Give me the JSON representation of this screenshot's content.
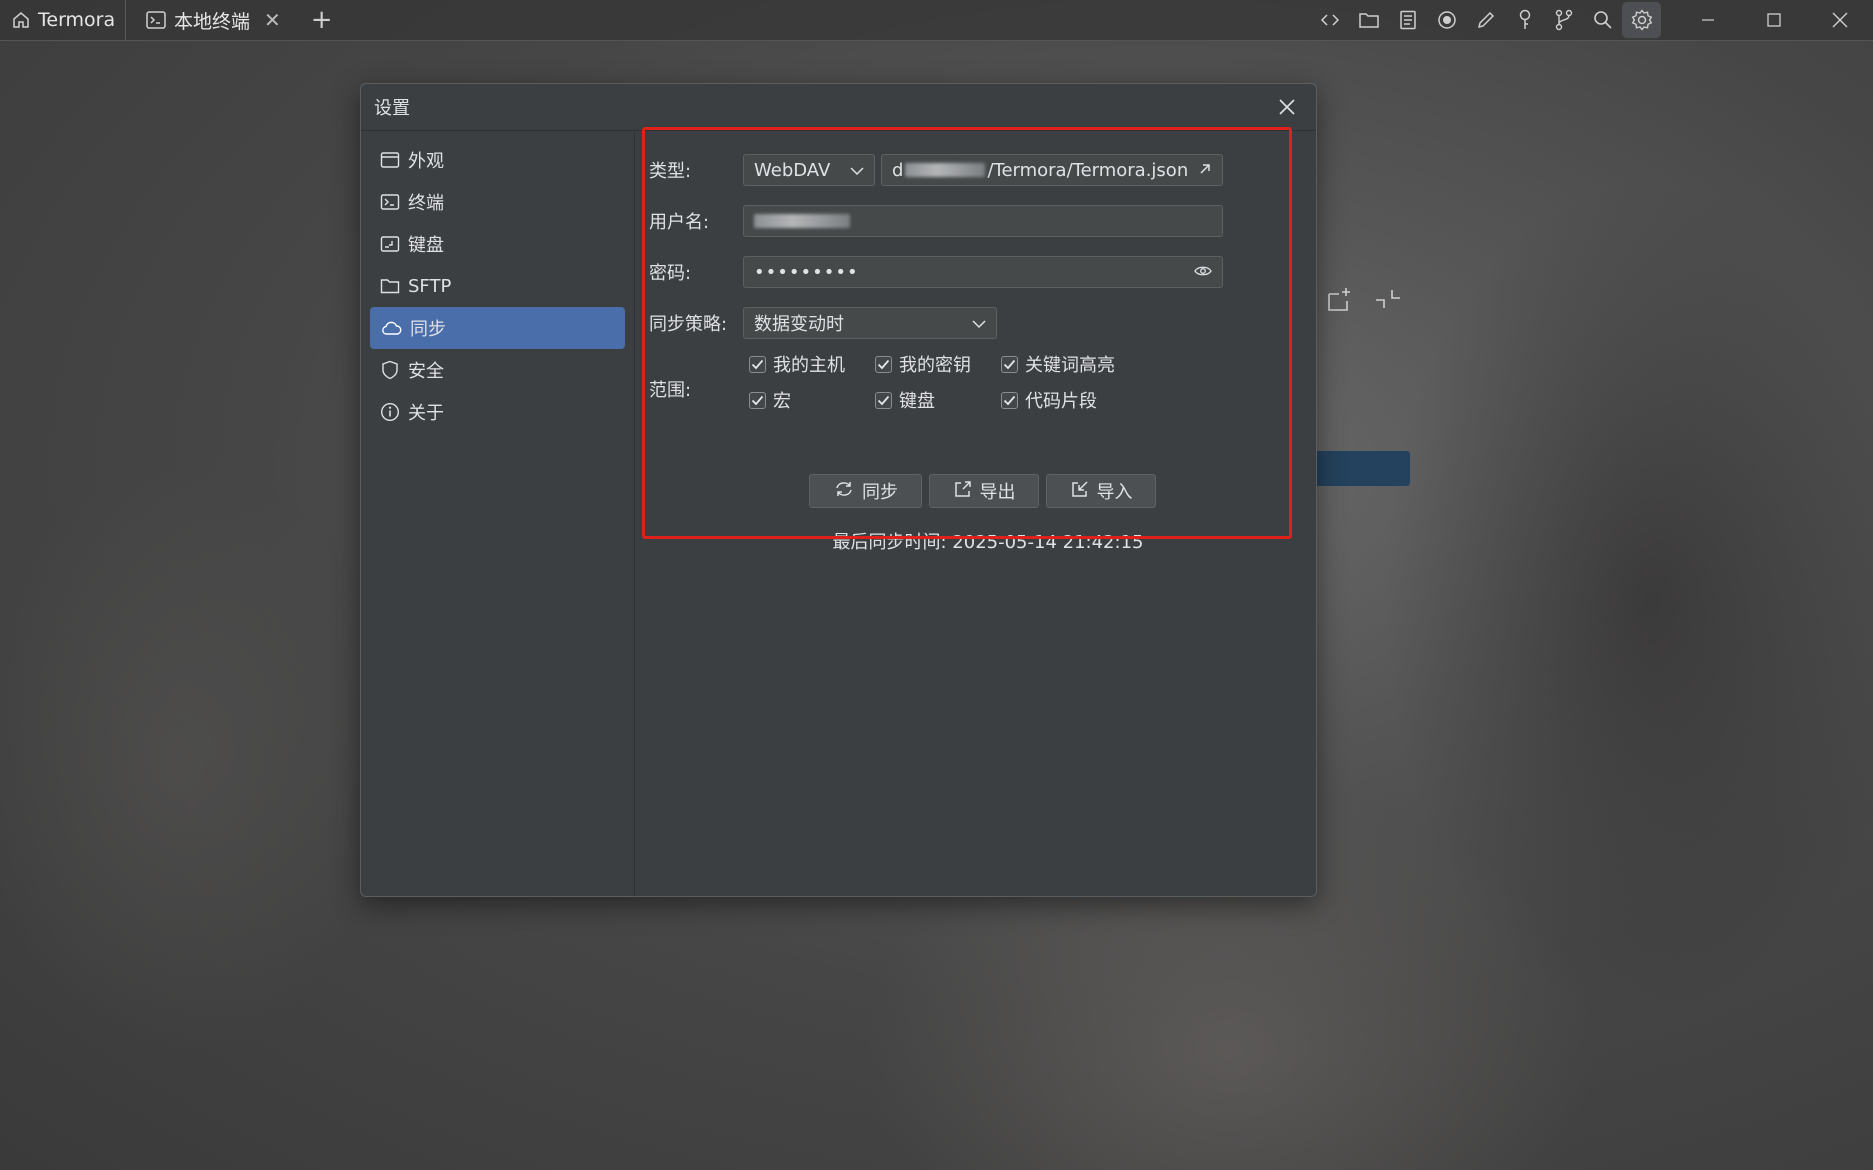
{
  "tabs": [
    {
      "label": "Termora",
      "icon": "home-icon"
    },
    {
      "label": "本地终端",
      "icon": "terminal-icon"
    }
  ],
  "toolbar_icons": [
    "code-icon",
    "folder-icon",
    "notes-icon",
    "record-icon",
    "pencil-icon",
    "key-pin-icon",
    "git-branch-icon",
    "search-icon",
    "gear-icon"
  ],
  "dialog": {
    "title": "设置",
    "sidebar": [
      {
        "label": "外观",
        "icon": "window-icon"
      },
      {
        "label": "终端",
        "icon": "terminal-icon"
      },
      {
        "label": "键盘",
        "icon": "keyboard-icon"
      },
      {
        "label": "SFTP",
        "icon": "folder-icon"
      },
      {
        "label": "同步",
        "icon": "cloud-icon",
        "selected": true
      },
      {
        "label": "安全",
        "icon": "shield-icon"
      },
      {
        "label": "关于",
        "icon": "info-icon"
      }
    ],
    "sync": {
      "type_label": "类型:",
      "type_value": "WebDAV",
      "url_visible": "d",
      "url_suffix": "/Termora/Termora.json",
      "username_label": "用户名:",
      "password_label": "密码:",
      "password_value": "•••••••••",
      "strategy_label": "同步策略:",
      "strategy_value": "数据变动时",
      "scope_label": "范围:",
      "scope": [
        {
          "label": "我的主机",
          "checked": true
        },
        {
          "label": "我的密钥",
          "checked": true
        },
        {
          "label": "关键词高亮",
          "checked": true
        },
        {
          "label": "宏",
          "checked": true
        },
        {
          "label": "键盘",
          "checked": true
        },
        {
          "label": "代码片段",
          "checked": true
        }
      ],
      "buttons": {
        "sync": "同步",
        "export": "导出",
        "import": "导入"
      },
      "last_sync": "最后同步时间: 2025-05-14 21:42:15"
    }
  },
  "colors": {
    "accent": "#4a6ea9",
    "highlight": "#e0201a",
    "panel": "#3c3f41"
  }
}
